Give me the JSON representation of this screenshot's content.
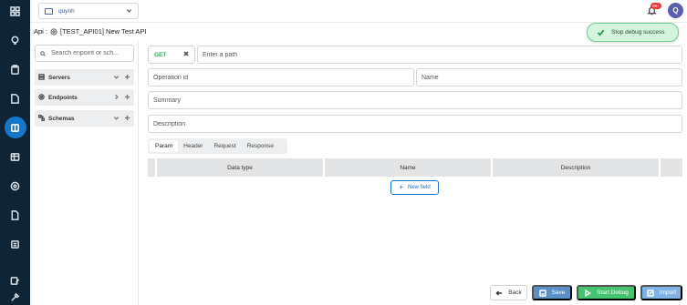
{
  "topbar": {
    "workspace": "quynh",
    "notifications_badge": "99+",
    "avatar_initial": "Q"
  },
  "breadcrumb": {
    "prefix": "Api :",
    "title": "[TEST_API01] New Test API"
  },
  "toast": {
    "message": "Stop debug success"
  },
  "sidebar": {
    "search_placeholder": "Search enpoint or sch...",
    "items": [
      {
        "label": "Servers",
        "icon": "server-icon",
        "chevron": "chevron-down-icon"
      },
      {
        "label": "Endpoints",
        "icon": "endpoint-icon",
        "chevron": "chevron-right-icon"
      },
      {
        "label": "Schemas",
        "icon": "schema-icon",
        "chevron": "chevron-down-icon"
      }
    ]
  },
  "form": {
    "method": "GET",
    "path_placeholder": "Enter a path",
    "operation_id_placeholder": "Operation id",
    "name_placeholder": "Name",
    "summary_placeholder": "Summary",
    "description_placeholder": "Description"
  },
  "tabs": [
    "Param",
    "Header",
    "Request",
    "Response"
  ],
  "table": {
    "columns": [
      "Data type",
      "Name",
      "Description"
    ],
    "new_field_label": "New field"
  },
  "actions": {
    "back": "Back",
    "save": "Save",
    "start_debug": "Start Debug",
    "import": "Import"
  },
  "colors": {
    "rail": "#0f2536",
    "accent": "#1677c9",
    "success": "#44c46e",
    "method_get": "#2eaa55"
  }
}
